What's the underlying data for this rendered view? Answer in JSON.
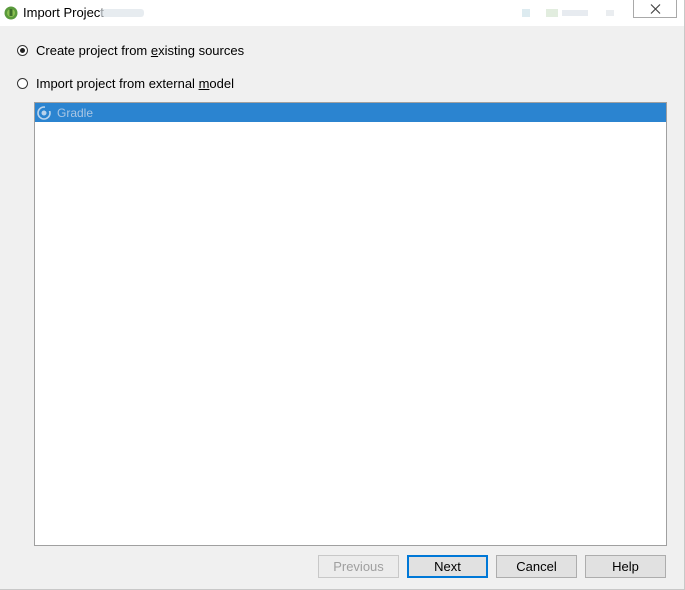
{
  "window": {
    "title": "Import Project"
  },
  "options": [
    {
      "label_before": "Create project from ",
      "mnemonic": "e",
      "label_after": "xisting sources",
      "checked": true
    },
    {
      "label_before": "Import project from external ",
      "mnemonic": "m",
      "label_after": "odel",
      "checked": false
    }
  ],
  "models": [
    {
      "label": "Gradle",
      "icon": "gradle-icon",
      "selected": true
    }
  ],
  "buttons": {
    "previous": "Previous",
    "next": "Next",
    "cancel": "Cancel",
    "help": "Help"
  },
  "colors": {
    "selection": "#2b84d0",
    "default_button_border": "#0078d7"
  }
}
